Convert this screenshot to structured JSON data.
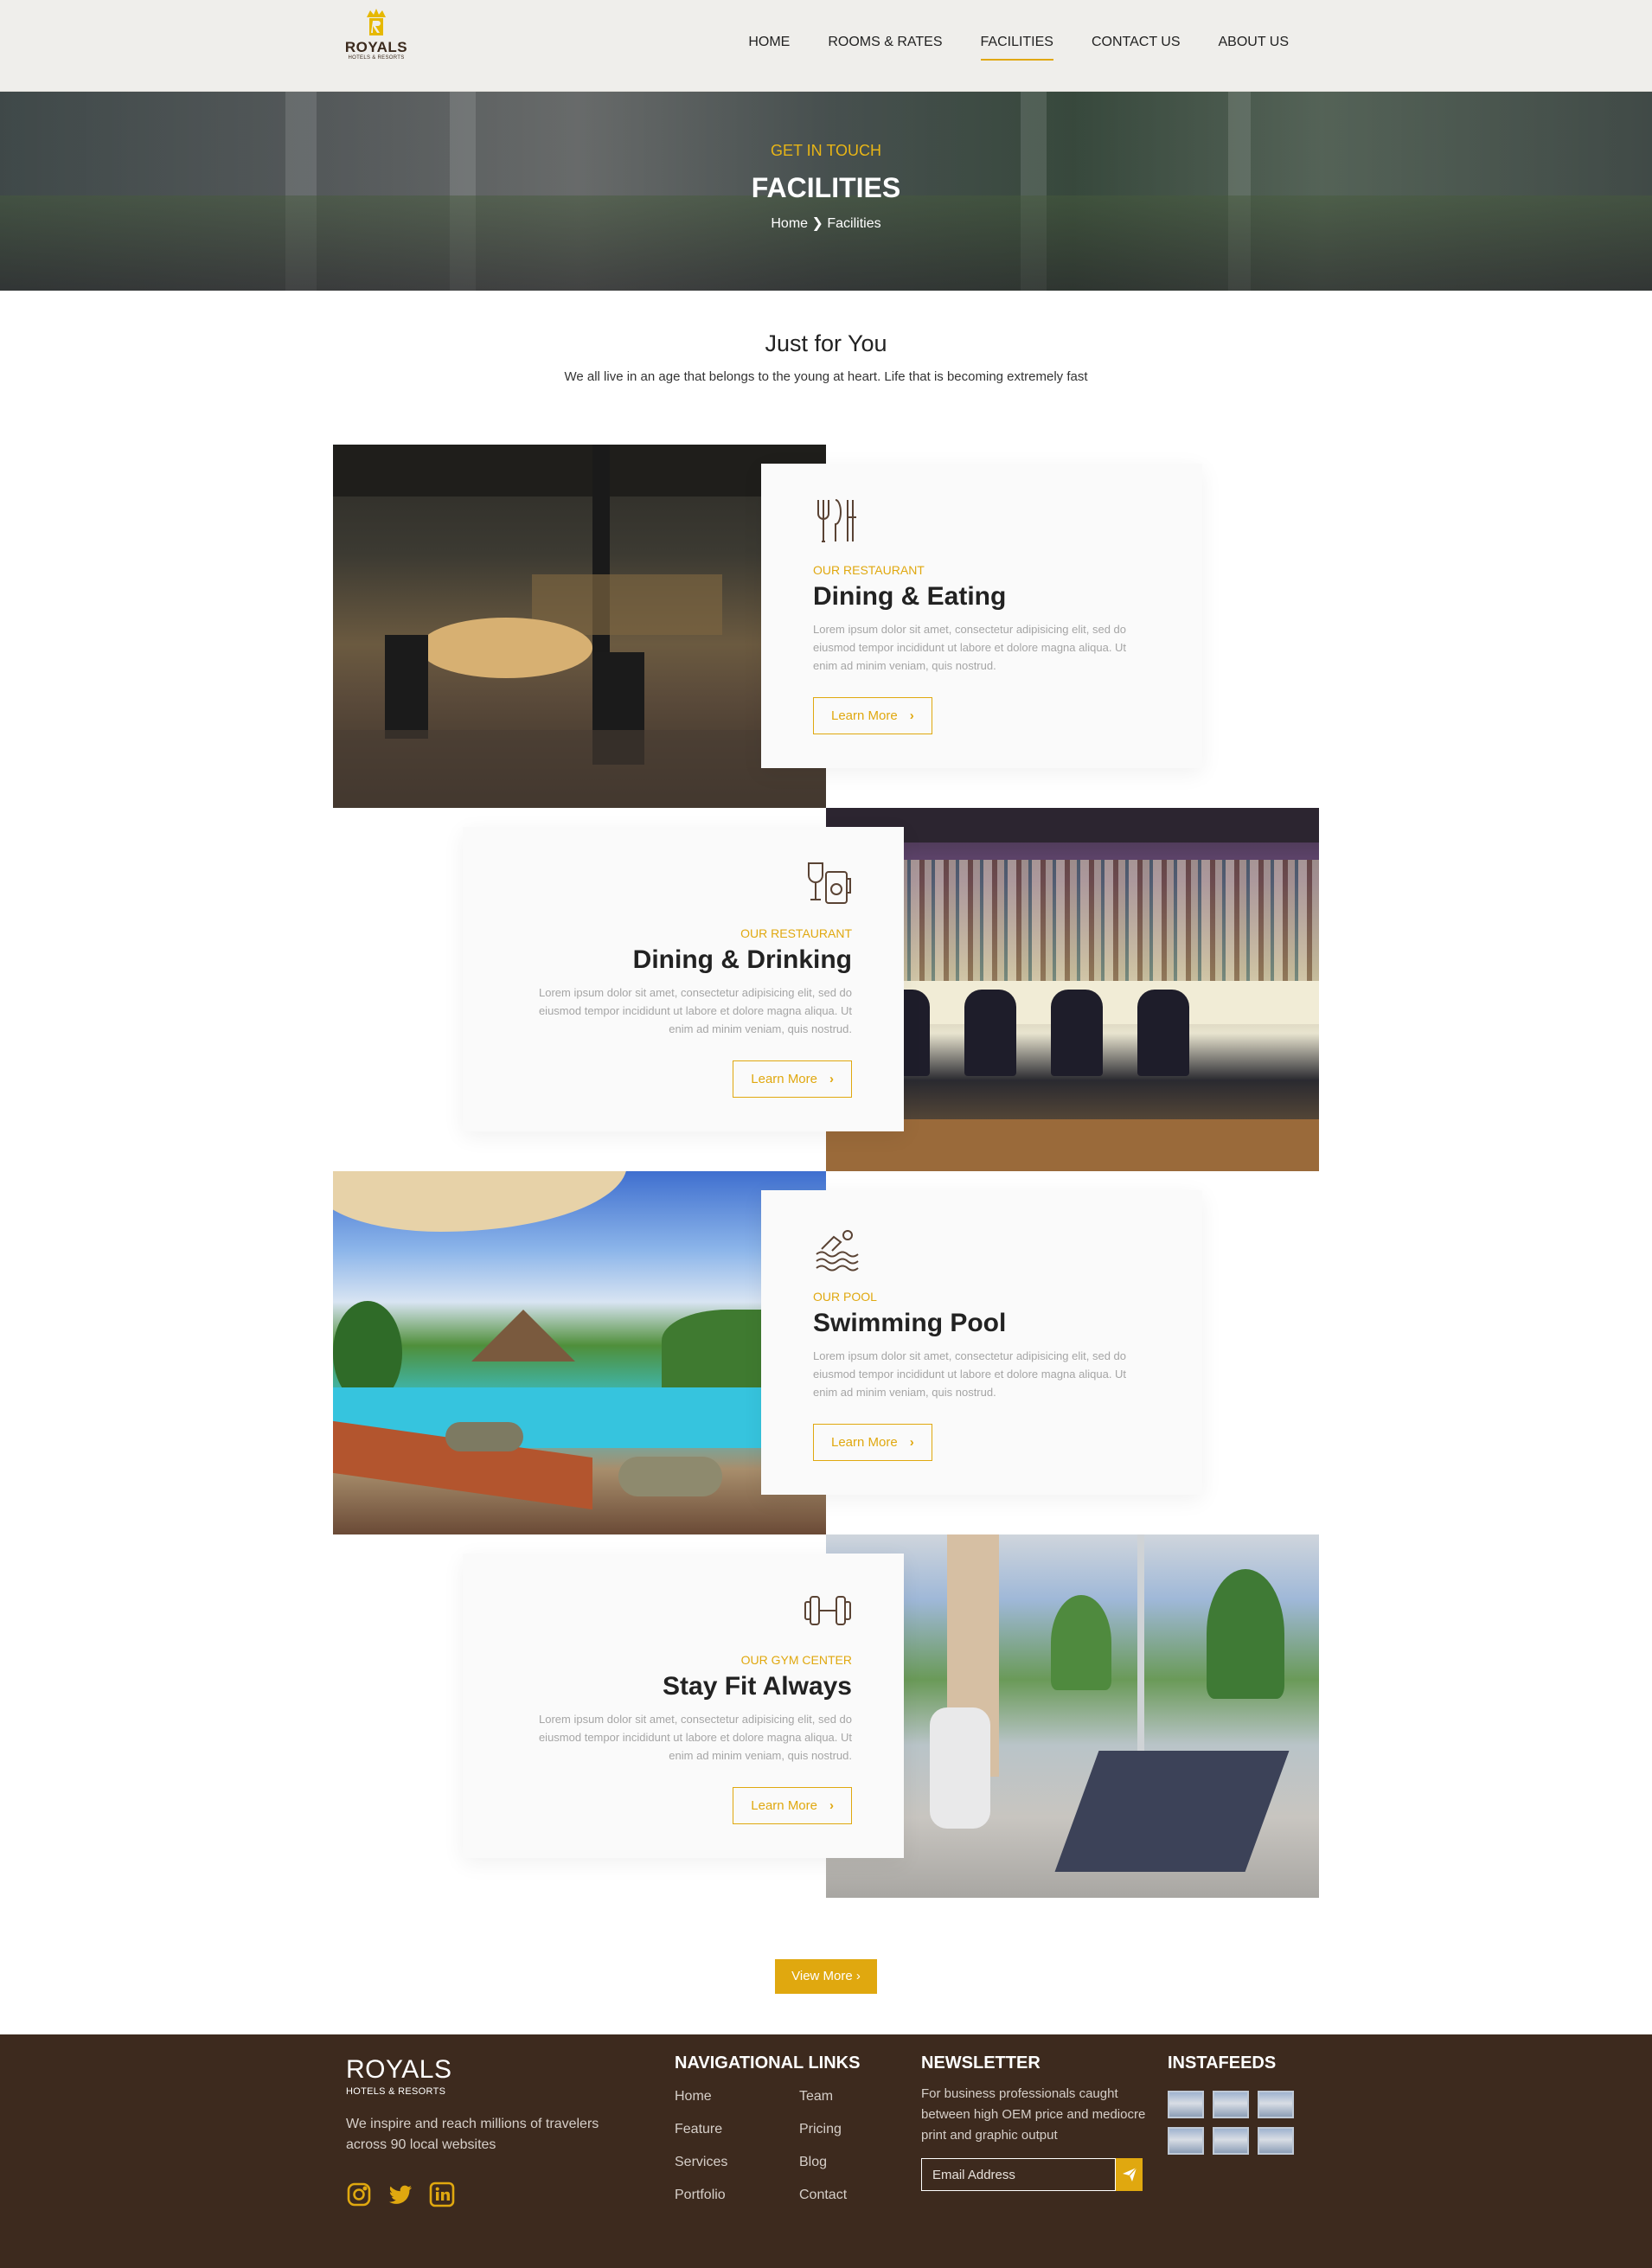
{
  "brand": {
    "name": "ROYALS",
    "tagline": "HOTELS & RESORTS"
  },
  "nav": {
    "items": [
      {
        "label": "HOME"
      },
      {
        "label": "ROOMS & RATES"
      },
      {
        "label": "FACILITIES"
      },
      {
        "label": "CONTACT US"
      },
      {
        "label": "ABOUT US"
      }
    ],
    "active": "FACILITIES"
  },
  "hero": {
    "kicker": "GET IN TOUCH",
    "title": "FACILITIES",
    "breadcrumb_home": "Home",
    "breadcrumb_separator": "❯",
    "breadcrumb_current": "Facilities"
  },
  "intro": {
    "title": "Just for You",
    "text": "We all live in an age that belongs to the young at heart. Life that is becoming extremely fast"
  },
  "facilities": [
    {
      "icon": "cutlery-icon",
      "kicker": "OUR RESTAURANT",
      "title": "Dining & Eating",
      "description": "Lorem ipsum dolor sit amet, consectetur adipisicing elit, sed do eiusmod tempor incididunt ut labore et dolore magna aliqua. Ut enim ad minim veniam, quis nostrud.",
      "button": "Learn More"
    },
    {
      "icon": "drinks-icon",
      "kicker": "OUR RESTAURANT",
      "title": "Dining & Drinking",
      "description": "Lorem ipsum dolor sit amet, consectetur adipisicing elit, sed do eiusmod tempor incididunt ut labore et dolore magna aliqua. Ut enim ad minim veniam, quis nostrud.",
      "button": "Learn More"
    },
    {
      "icon": "swimmer-icon",
      "kicker": "OUR POOL",
      "title": "Swimming Pool",
      "description": "Lorem ipsum dolor sit amet, consectetur adipisicing elit, sed do eiusmod tempor incididunt ut labore et dolore magna aliqua. Ut enim ad minim veniam, quis nostrud.",
      "button": "Learn More"
    },
    {
      "icon": "dumbbell-icon",
      "kicker": "OUR GYM CENTER",
      "title": "Stay Fit Always",
      "description": "Lorem ipsum dolor sit amet, consectetur adipisicing elit, sed do eiusmod tempor incididunt ut labore et dolore magna aliqua. Ut enim ad minim veniam, quis nostrud.",
      "button": "Learn More"
    }
  ],
  "view_more": "View More ›",
  "footer": {
    "brand": "ROYALS",
    "brand_sub": "HOTELS & RESORTS",
    "tagline": "We inspire and reach millions of travelers across 90 local websites",
    "social": [
      "instagram-icon",
      "twitter-icon",
      "linkedin-icon"
    ],
    "nav_heading": "NAVIGATIONAL LINKS",
    "nav_links": [
      "Home",
      "Team",
      "Feature",
      "Pricing",
      "Services",
      "Blog",
      "Portfolio",
      "Contact"
    ],
    "newsletter_heading": "NEWSLETTER",
    "newsletter_text": "For business professionals caught between high OEM price and mediocre print and graphic output",
    "newsletter_placeholder": "Email Address",
    "insta_heading": "INSTAFEEDS"
  },
  "colors": {
    "accent": "#e0a80f",
    "footer_bg": "#3d2a1e",
    "header_bg": "#efeeeb"
  }
}
